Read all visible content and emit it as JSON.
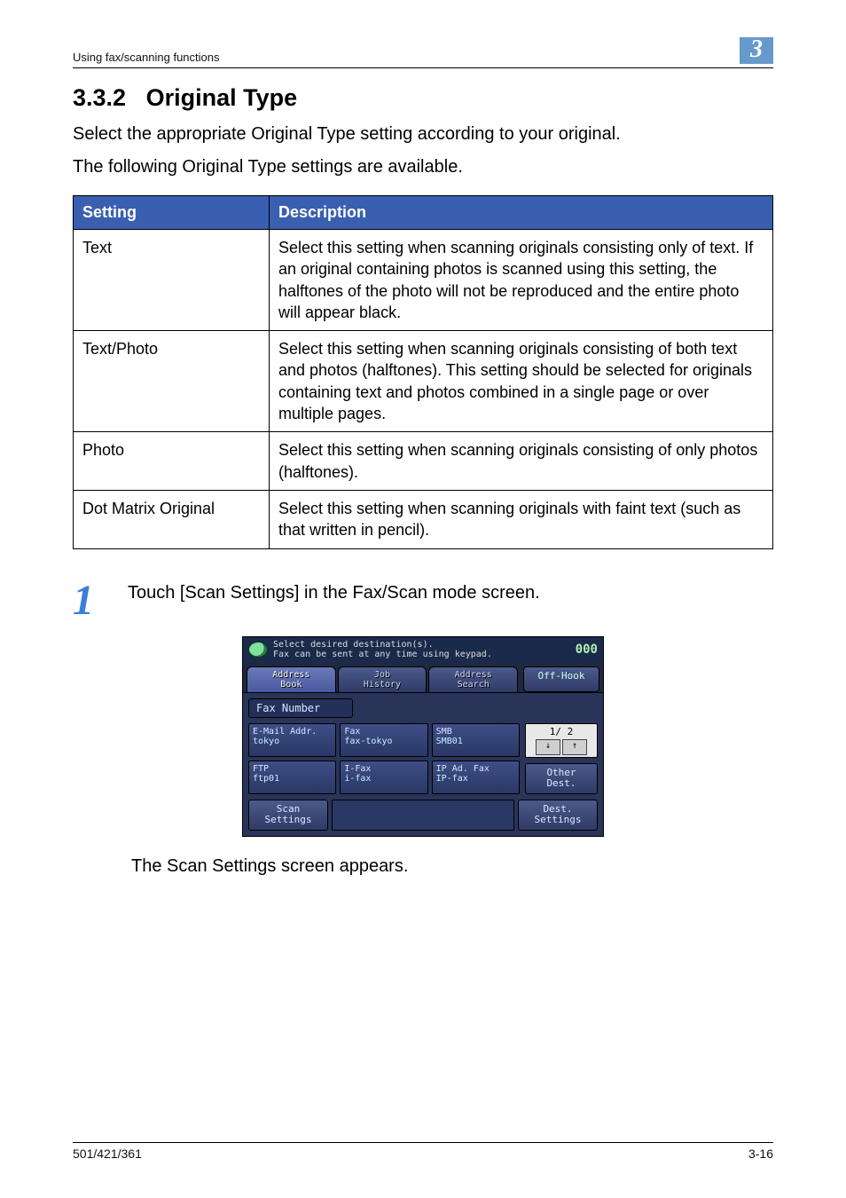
{
  "header": {
    "running": "Using fax/scanning functions",
    "chapter_badge": "3"
  },
  "section": {
    "number": "3.3.2",
    "title": "Original Type",
    "intro1": "Select the appropriate Original Type setting according to your original.",
    "intro2": "The following Original Type settings are available."
  },
  "table": {
    "head_setting": "Setting",
    "head_desc": "Description",
    "rows": [
      {
        "setting": "Text",
        "desc": "Select this setting when scanning originals consisting only of text. If an original containing photos is scanned using this setting, the halftones of the photo will not be reproduced and the entire photo will appear black."
      },
      {
        "setting": "Text/Photo",
        "desc": "Select this setting when scanning originals consisting of both text and photos (halftones). This setting should be selected for originals containing text and photos combined in a single page or over multiple pages."
      },
      {
        "setting": "Photo",
        "desc": "Select this setting when scanning originals consisting of only photos (halftones)."
      },
      {
        "setting": "Dot Matrix Original",
        "desc": "Select this setting when scanning originals with faint text (such as that written in pencil)."
      }
    ]
  },
  "step": {
    "num": "1",
    "text": "Touch [Scan Settings] in the Fax/Scan mode screen.",
    "after": "The Scan Settings screen appears."
  },
  "device": {
    "title1": "Select desired destination(s).",
    "title2": "Fax can be sent at any time using keypad.",
    "counter": "000",
    "tabs": {
      "address_book": "Address\nBook",
      "job_history": "Job\nHistory",
      "address_search": "Address\nSearch"
    },
    "off_hook": "Off-Hook",
    "fax_number_label": "Fax Number",
    "dest": [
      {
        "type": "E-Mail Addr.",
        "name": "tokyo"
      },
      {
        "type": "Fax",
        "name": "fax-tokyo"
      },
      {
        "type": "SMB",
        "name": "SMB01"
      },
      {
        "type": "FTP",
        "name": "ftp01"
      },
      {
        "type": "I-Fax",
        "name": "i-fax"
      },
      {
        "type": "IP Ad. Fax",
        "name": "IP-fax"
      }
    ],
    "pager": "1/  2",
    "other_dest": "Other\nDest.",
    "scan_settings": "Scan\nSettings",
    "dest_settings": "Dest.\nSettings"
  },
  "footer": {
    "left": "501/421/361",
    "right": "3-16"
  }
}
